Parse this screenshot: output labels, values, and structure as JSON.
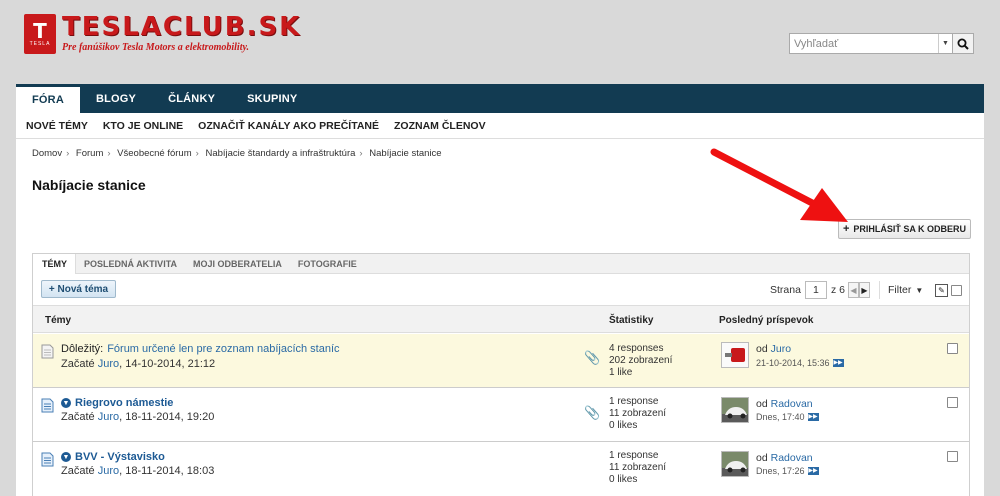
{
  "site": {
    "logo_badge_letter": "T",
    "logo_badge_text": "TESLA",
    "logo_title": "TESLACLUB.SK",
    "logo_subtitle": "Pre fanúšikov Tesla Motors a elektromobility.",
    "search_placeholder": "Vyhľadať"
  },
  "nav": {
    "items": [
      "FÓRA",
      "BLOGY",
      "ČLÁNKY",
      "SKUPINY"
    ],
    "subitems": [
      "NOVÉ TÉMY",
      "KTO JE ONLINE",
      "OZNAČIŤ KANÁLY AKO PREČÍTANÉ",
      "ZOZNAM ČLENOV"
    ]
  },
  "breadcrumb": [
    "Domov",
    "Forum",
    "Všeobecné fórum",
    "Nabíjacie štandardy a infraštruktúra",
    "Nabíjacie stanice"
  ],
  "page_title": "Nabíjacie stanice",
  "subscribe_label": "PRIHLÁSIŤ SA K ODBERU",
  "tabs": [
    "TÉMY",
    "POSLEDNÁ AKTIVITA",
    "MOJI ODBERATELIA",
    "FOTOGRAFIE"
  ],
  "toolbar": {
    "new_topic": "+ Nová téma",
    "page_label": "Strana",
    "page_value": "1",
    "page_of": "z 6",
    "filter": "Filter"
  },
  "table": {
    "headers": [
      "Témy",
      "Štatistiky",
      "Posledný príspevok"
    ],
    "rows": [
      {
        "prefix": "Dôležitý:",
        "title": "Fórum určené len pre zoznam nabíjacích staníc",
        "started_label": "Začaté",
        "author": "Juro",
        "date": ", 14-10-2014, 21:12",
        "stats": [
          "4 responses",
          "202 zobrazení",
          "1 like"
        ],
        "last_by_label": "od",
        "last_by": "Juro",
        "last_date": "21-10-2014, 15:36"
      },
      {
        "prefix": "",
        "title": "Riegrovo námestie",
        "started_label": "Začaté",
        "author": "Juro",
        "date": ", 18-11-2014, 19:20",
        "stats": [
          "1 response",
          "11 zobrazení",
          "0 likes"
        ],
        "last_by_label": "od",
        "last_by": "Radovan",
        "last_date": "Dnes, 17:40"
      },
      {
        "prefix": "",
        "title": "BVV - Výstavisko",
        "started_label": "Začaté",
        "author": "Juro",
        "date": ", 18-11-2014, 18:03",
        "stats": [
          "1 response",
          "11 zobrazení",
          "0 likes"
        ],
        "last_by_label": "od",
        "last_by": "Radovan",
        "last_date": "Dnes, 17:26"
      }
    ]
  },
  "colors": {
    "navbar": "#123b52",
    "brand_red": "#c8191b",
    "link": "#2a6aa5",
    "sticky_row": "#fcf9de",
    "annotation_arrow": "#ee1111"
  }
}
